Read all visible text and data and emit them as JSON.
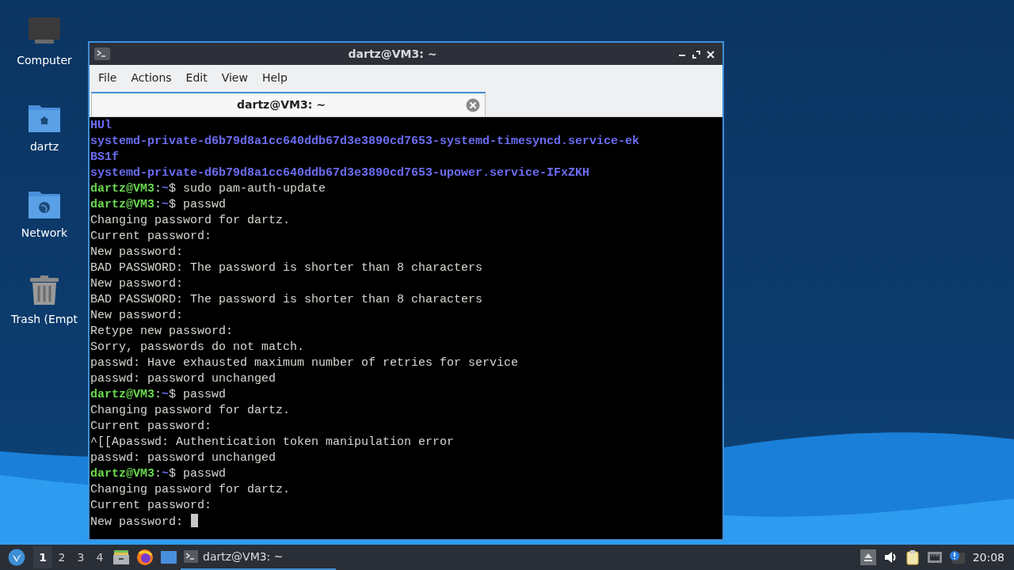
{
  "desktop": {
    "icons": [
      {
        "label": "Computer",
        "kind": "computer"
      },
      {
        "label": "dartz",
        "kind": "home"
      },
      {
        "label": "Network",
        "kind": "network"
      },
      {
        "label": "Trash (Empt",
        "kind": "trash"
      }
    ]
  },
  "window": {
    "title": "dartz@VM3: ~",
    "menu": [
      "File",
      "Actions",
      "Edit",
      "View",
      "Help"
    ],
    "tabs": [
      {
        "label": "dartz@VM3: ~",
        "selected": true
      }
    ],
    "terminal": {
      "lines": [
        {
          "kind": "dir",
          "text": "HUl"
        },
        {
          "kind": "dir",
          "text": "systemd-private-d6b79d8a1cc640ddb67d3e3890cd7653-systemd-timesyncd.service-ek"
        },
        {
          "kind": "dir",
          "text": "BS1f"
        },
        {
          "kind": "dir",
          "text": "systemd-private-d6b79d8a1cc640ddb67d3e3890cd7653-upower.service-IFxZKH"
        },
        {
          "kind": "prompt",
          "host": "dartz@VM3",
          "sep": ":",
          "path": "~",
          "sign": "$",
          "command": "sudo pam-auth-update"
        },
        {
          "kind": "prompt",
          "host": "dartz@VM3",
          "sep": ":",
          "path": "~",
          "sign": "$",
          "command": "passwd"
        },
        {
          "kind": "output",
          "text": "Changing password for dartz."
        },
        {
          "kind": "output",
          "text": "Current password:"
        },
        {
          "kind": "output",
          "text": "New password:"
        },
        {
          "kind": "output",
          "text": "BAD PASSWORD: The password is shorter than 8 characters"
        },
        {
          "kind": "output",
          "text": "New password:"
        },
        {
          "kind": "output",
          "text": "BAD PASSWORD: The password is shorter than 8 characters"
        },
        {
          "kind": "output",
          "text": "New password:"
        },
        {
          "kind": "output",
          "text": "Retype new password:"
        },
        {
          "kind": "output",
          "text": "Sorry, passwords do not match."
        },
        {
          "kind": "output",
          "text": "passwd: Have exhausted maximum number of retries for service"
        },
        {
          "kind": "output",
          "text": "passwd: password unchanged"
        },
        {
          "kind": "prompt",
          "host": "dartz@VM3",
          "sep": ":",
          "path": "~",
          "sign": "$",
          "command": "passwd"
        },
        {
          "kind": "output",
          "text": "Changing password for dartz."
        },
        {
          "kind": "output",
          "text": "Current password:"
        },
        {
          "kind": "output",
          "text": "^[[Apasswd: Authentication token manipulation error"
        },
        {
          "kind": "output",
          "text": "passwd: password unchanged"
        },
        {
          "kind": "prompt",
          "host": "dartz@VM3",
          "sep": ":",
          "path": "~",
          "sign": "$",
          "command": "passwd"
        },
        {
          "kind": "output",
          "text": "Changing password for dartz."
        },
        {
          "kind": "output",
          "text": "Current password:"
        },
        {
          "kind": "output",
          "text": "New password:",
          "cursor": true
        }
      ]
    }
  },
  "taskbar": {
    "workspaces": [
      {
        "label": "1",
        "selected": true
      },
      {
        "label": "2",
        "selected": false
      },
      {
        "label": "3",
        "selected": false
      },
      {
        "label": "4",
        "selected": false
      }
    ],
    "tasks": [
      {
        "label": "dartz@VM3: ~",
        "selected": true
      }
    ],
    "clock": "20:08"
  }
}
